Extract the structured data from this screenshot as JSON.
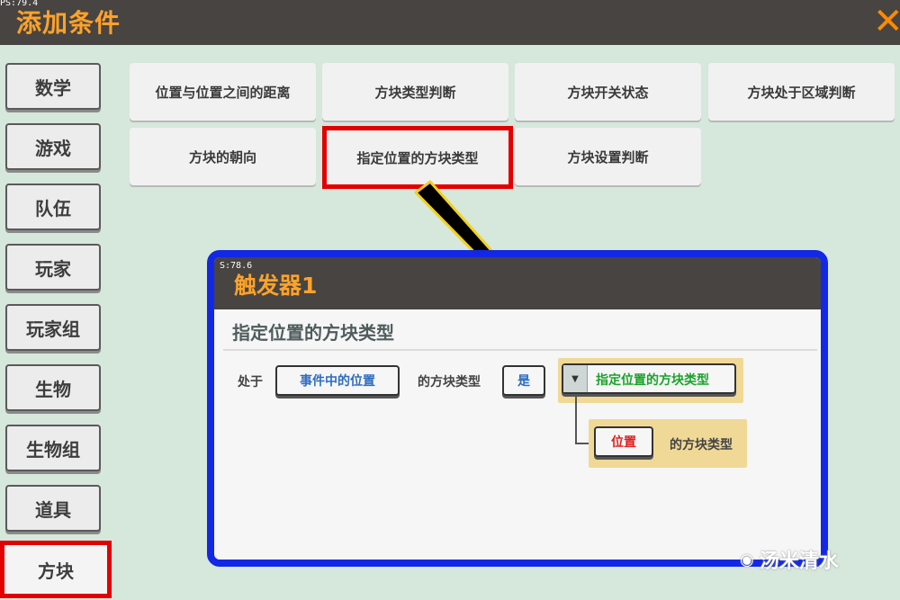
{
  "window": {
    "fps": "PS:79.4",
    "title": "添加条件",
    "close_icon": "close-icon",
    "accent_color": "#ffa22a"
  },
  "sidebar": {
    "items": [
      {
        "label": "数学"
      },
      {
        "label": "游戏"
      },
      {
        "label": "队伍"
      },
      {
        "label": "玩家"
      },
      {
        "label": "玩家组"
      },
      {
        "label": "生物"
      },
      {
        "label": "生物组"
      },
      {
        "label": "道具"
      },
      {
        "label": "方块",
        "selected": true
      }
    ]
  },
  "conditions": {
    "items": [
      {
        "label": "位置与位置之间的距离"
      },
      {
        "label": "方块类型判断"
      },
      {
        "label": "方块开关状态"
      },
      {
        "label": "方块处于区域判断"
      },
      {
        "label": "方块的朝向"
      },
      {
        "label": "指定位置的方块类型",
        "highlighted": true
      },
      {
        "label": "方块设置判断"
      }
    ]
  },
  "popup": {
    "fps": "S:78.6",
    "title": "触发器1",
    "subtitle": "指定位置的方块类型",
    "row": {
      "prefix": "处于",
      "position_button": "事件中的位置",
      "middle_label": "的方块类型",
      "is_button": "是",
      "dropdown_value": "指定位置的方块类型"
    },
    "sub_row": {
      "position_button": "位置",
      "suffix": "的方块类型"
    },
    "highlight_color": "#1228e6"
  },
  "watermark": {
    "text": "汤米清水",
    "icon": "wechat-icon"
  }
}
